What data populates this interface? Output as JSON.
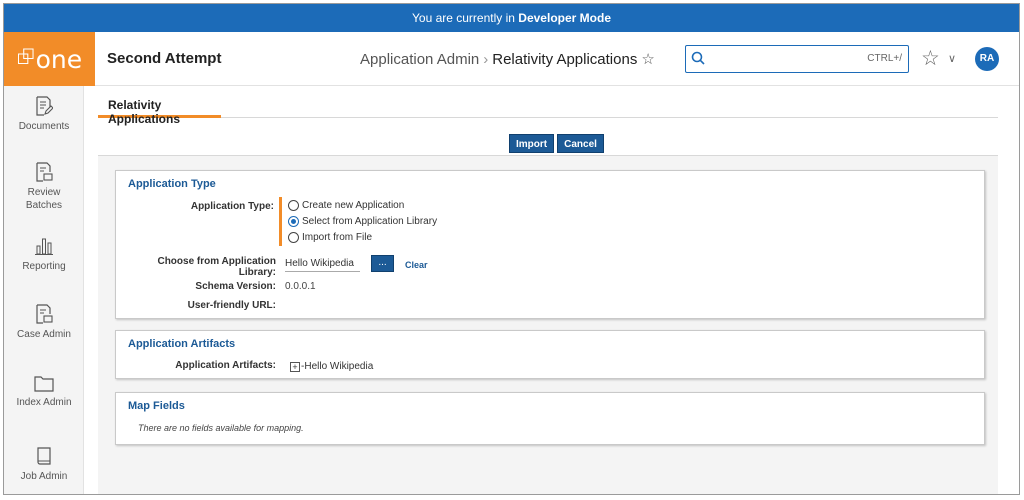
{
  "devbar": {
    "prefix": "You are currently in ",
    "mode": "Developer Mode"
  },
  "header": {
    "logo": "One",
    "workspace": "Second Attempt",
    "breadcrumb": {
      "parent": "Application Admin",
      "current": "Relativity Applications"
    },
    "search": {
      "shortcut": "CTRL+/"
    },
    "avatar": "RA"
  },
  "sidebar": {
    "items": [
      {
        "label": "Documents",
        "icon": "document-edit-icon"
      },
      {
        "label": "Review Batches",
        "icon": "batches-icon"
      },
      {
        "label": "Reporting",
        "icon": "bar-chart-icon"
      },
      {
        "label": "Case Admin",
        "icon": "case-admin-icon"
      },
      {
        "label": "Index Admin",
        "icon": "folder-icon"
      },
      {
        "label": "Job Admin",
        "icon": "book-icon"
      }
    ]
  },
  "tabs": [
    {
      "label": "Relativity Applications",
      "active": true
    }
  ],
  "actions": {
    "import": "Import",
    "cancel": "Cancel"
  },
  "application_type": {
    "title": "Application Type",
    "type_label": "Application Type:",
    "options": [
      {
        "label": "Create new Application",
        "selected": false
      },
      {
        "label": "Select from Application Library",
        "selected": true
      },
      {
        "label": "Import from File",
        "selected": false
      }
    ],
    "library_label": "Choose from Application Library:",
    "library_value": "Hello Wikipedia",
    "picker_label": "...",
    "clear_label": "Clear",
    "schema_label": "Schema Version:",
    "schema_value": "0.0.0.1",
    "url_label": "User-friendly URL:"
  },
  "artifacts": {
    "title": "Application Artifacts",
    "label": "Application Artifacts:",
    "tree_item": "Hello Wikipedia"
  },
  "map_fields": {
    "title": "Map Fields",
    "empty_message": "There are no fields available for mapping."
  },
  "colors": {
    "brand_orange": "#f28c28",
    "primary_blue": "#1c6bb8",
    "dark_blue": "#1c5a96"
  }
}
